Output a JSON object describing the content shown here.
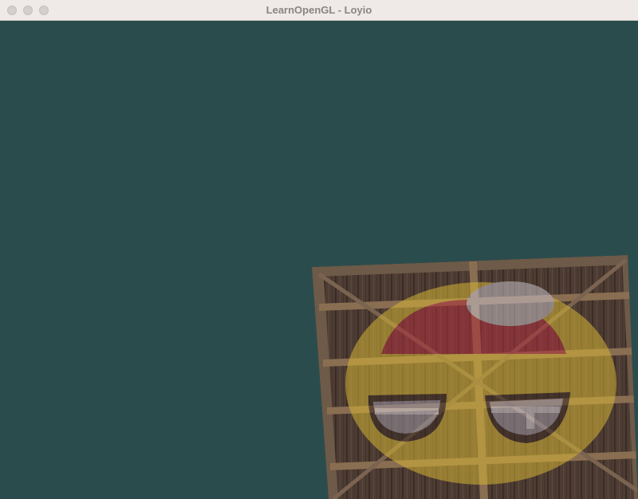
{
  "window": {
    "title": "LearnOpenGL - Loyio"
  },
  "colors": {
    "clear_color": "#2b4c4d",
    "crate_wood": "#4a3a32",
    "crate_beam": "#8a6a48",
    "face_yellow": "#c8a83a",
    "face_red": "#8c2b3a"
  },
  "icons": {
    "close": "close-icon",
    "minimize": "minimize-icon",
    "zoom": "zoom-icon"
  }
}
